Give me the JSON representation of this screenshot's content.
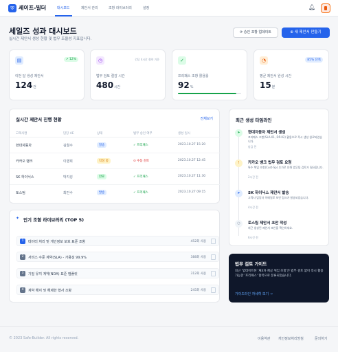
{
  "header": {
    "brand": "세이프-빌더",
    "nav": [
      "대시보드",
      "제안서 관리",
      "조항 라이브러리",
      "설정"
    ]
  },
  "page": {
    "title": "세일즈 성과 대시보드",
    "subtitle": "실시간 제안서 생성 현황 및 법무 조율성 지표입니다.",
    "btn_secondary": "승인 조항 업데이트",
    "btn_primary": "새 제안서 만들기"
  },
  "stats": [
    {
      "label": "이번 달 생성 제안서",
      "value": "124",
      "unit": "건",
      "badge": "↗ 12%"
    },
    {
      "label": "법무 검토 절감 시간",
      "value": "480",
      "unit": "시간",
      "note": "건당 4시간 절약 기준"
    },
    {
      "label": "프리패스 조항 활용률",
      "value": "92",
      "unit": "%",
      "progress": 0.92
    },
    {
      "label": "평균 제안서 완성 시간",
      "value": "15",
      "unit": "분",
      "badge": "85% 단축"
    }
  ],
  "table": {
    "title": "실시간 제안서 진행 현황",
    "link": "전체보기",
    "headers": [
      "고객사명",
      "담당 AE",
      "상태",
      "법무 승인 여부",
      "생성 일시"
    ],
    "rows": [
      {
        "client": "현대자동차",
        "ae": "김철수",
        "status": "발송",
        "review": "✓ 프리패스",
        "date": "2023.10.27 15:20"
      },
      {
        "client": "카카오 뱅크",
        "ae": "이영희",
        "status": "작성 중",
        "review": "⊙ 수동 검토",
        "date": "2023.10.27 12:45"
      },
      {
        "client": "SK 하이닉스",
        "ae": "박지성",
        "status": "완료",
        "review": "✓ 프리패스",
        "date": "2023.10.27 11:30"
      },
      {
        "client": "토스팀",
        "ae": "최민수",
        "status": "발송",
        "review": "✓ 프리패스",
        "date": "2023.10.27 09:15"
      }
    ]
  },
  "library": {
    "title": "인기 조항 라이브러리 (TOP 5)",
    "items": [
      {
        "rank": "1",
        "title": "데이터 처리 및 개인정보 보호 표준 조항",
        "count": "452회 사용"
      },
      {
        "rank": "2",
        "title": "서비스 수준 계약(SLA) - 가용성 99.9%",
        "count": "388회 사용"
      },
      {
        "rank": "3",
        "title": "기밀 유지 계약(NDA) 표준 템플릿",
        "count": "312회 사용"
      },
      {
        "rank": "4",
        "title": "계약 해지 및 해제한 행사 조항",
        "count": "245회 사용"
      }
    ]
  },
  "timeline": {
    "title": "최근 생성 타임라인",
    "items": [
      {
        "title": "현대자동차 제안서 생성",
        "desc": "프리패스 조항(SLA-01, DP-02) 활용으로 즉시 생성 완료되었습니다.",
        "time": "방금 전"
      },
      {
        "title": "카카오 뱅크 법무 검토 요청",
        "desc": "특수 책임 조항(Cust-Sp) 추가로 인해 법무팀 검토가 필요합니다.",
        "time": "2시간 전"
      },
      {
        "title": "SK 하이닉스 제안서 발송",
        "desc": "고객사 담당자 이메일로 보안 링크가 발송되었습니다.",
        "time": "4시간 전"
      },
      {
        "title": "토스팀 제안서 초안 작성",
        "desc": "최근 생성된 제안서 초안을 확인하세요.",
        "time": "6시간 전"
      }
    ]
  },
  "guide": {
    "title": "법무 검토 가이드",
    "text": "최근 '업데이트된 '재3자 제공 위임 조항'은 법무 검토 없이 즉시 활용 가능한 '프리패스' 항목으로 분류되었습니다.",
    "link": "가이드라인 자세히 보기 →"
  },
  "footer": {
    "copyright": "© 2023 Safe-Builder. All rights reserved.",
    "links": [
      "이용약관",
      "개인정보처리방침",
      "문의하기"
    ]
  },
  "colors": {
    "primary": "#2563eb",
    "success": "#16a34a",
    "warning": "#d97706",
    "danger": "#dc2626",
    "dark": "#0f172a"
  }
}
